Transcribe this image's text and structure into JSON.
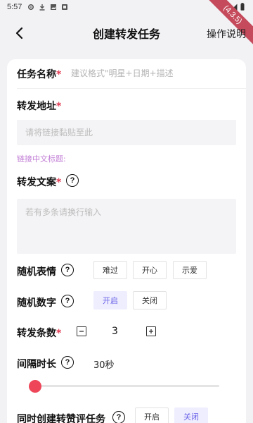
{
  "status": {
    "time": "5:57"
  },
  "ribbon": "(4.3.5)",
  "nav": {
    "title": "创建转发任务",
    "help": "操作说明"
  },
  "task_name": {
    "label": "任务名称",
    "required": "*",
    "placeholder": "建议格式\"明星+日期+描述"
  },
  "forward_url": {
    "label": "转发地址",
    "required": "*",
    "placeholder": "请将链接黏贴至此",
    "hint": "链接中文标题:"
  },
  "forward_text": {
    "label": "转发文案",
    "required": "*",
    "placeholder": "若有多条请换行输入"
  },
  "random_emoji": {
    "label": "随机表情",
    "options": [
      "难过",
      "开心",
      "示爱"
    ]
  },
  "random_number": {
    "label": "随机数字",
    "options": [
      "开启",
      "关闭"
    ],
    "selected": "开启"
  },
  "forward_count": {
    "label": "转发条数",
    "required": "*",
    "value": "3"
  },
  "interval": {
    "label": "间隔时长",
    "value": "30秒",
    "slider_fraction": 0.0
  },
  "also_create": {
    "label": "同时创建转赞评任务",
    "options": [
      "开启",
      "关闭"
    ],
    "selected": "关闭"
  },
  "help_symbol": "?",
  "colors": {
    "accent": "#6a63e8",
    "required": "#e23d56",
    "slider": "#ee4558",
    "hint": "#c27ed6"
  }
}
